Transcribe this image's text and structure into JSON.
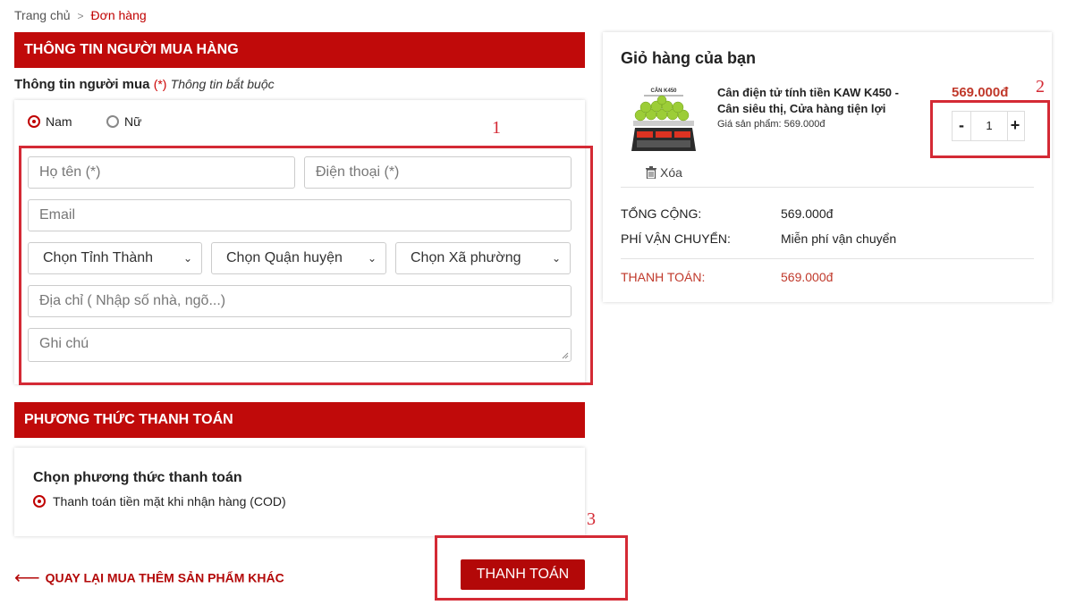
{
  "breadcrumb": {
    "home": "Trang chủ",
    "current": "Đơn hàng"
  },
  "buyer_section": {
    "title": "THÔNG TIN NGƯỜI MUA HÀNG",
    "label": "Thông tin người mua",
    "required_mark": "(*)",
    "required_note": "Thông tin bắt buộc",
    "gender_options": [
      {
        "label": "Nam",
        "selected": true
      },
      {
        "label": "Nữ",
        "selected": false
      }
    ],
    "fields": {
      "name_placeholder": "Họ tên (*)",
      "phone_placeholder": "Điện thoại (*)",
      "email_placeholder": "Email",
      "province": "Chọn Tỉnh Thành",
      "district": "Chọn Quận huyện",
      "ward": "Chọn Xã phường",
      "address_placeholder": "Địa chỉ ( Nhập số nhà, ngõ...)",
      "note_placeholder": "Ghi chú"
    }
  },
  "payment_section": {
    "title": "PHƯƠNG THỨC THANH TOÁN",
    "choose_label": "Chọn phương thức thanh toán",
    "option": "Thanh toán tiền mặt khi nhận hàng (COD)"
  },
  "actions": {
    "back_arrow": "⟵",
    "back_label": "QUAY LẠI MUA THÊM SẢN PHẨM KHÁC",
    "pay_button": "THANH TOÁN"
  },
  "cart": {
    "title": "Giỏ hàng của bạn",
    "product": {
      "image_caption": "CÂN K450",
      "name": "Cân điện tử tính tiền KAW K450 - Cân siêu thị, Cửa hàng tiện lợi",
      "unit_price_note": "Giá sản phẩm: 569.000đ",
      "price": "569.000đ",
      "quantity": "1",
      "minus": "-",
      "plus": "+",
      "remove": "Xóa"
    },
    "summary": {
      "total_label": "TỔNG CỘNG:",
      "total_value": "569.000đ",
      "shipping_label": "PHÍ VẬN CHUYỂN:",
      "shipping_value": "Miễn phí vận chuyển",
      "pay_label": "THANH TOÁN:",
      "pay_value": "569.000đ"
    }
  },
  "annotations": {
    "n1": "1",
    "n2": "2",
    "n3": "3"
  },
  "colors": {
    "brand_red": "#c00a0a",
    "annotation_red": "#d42a35"
  }
}
